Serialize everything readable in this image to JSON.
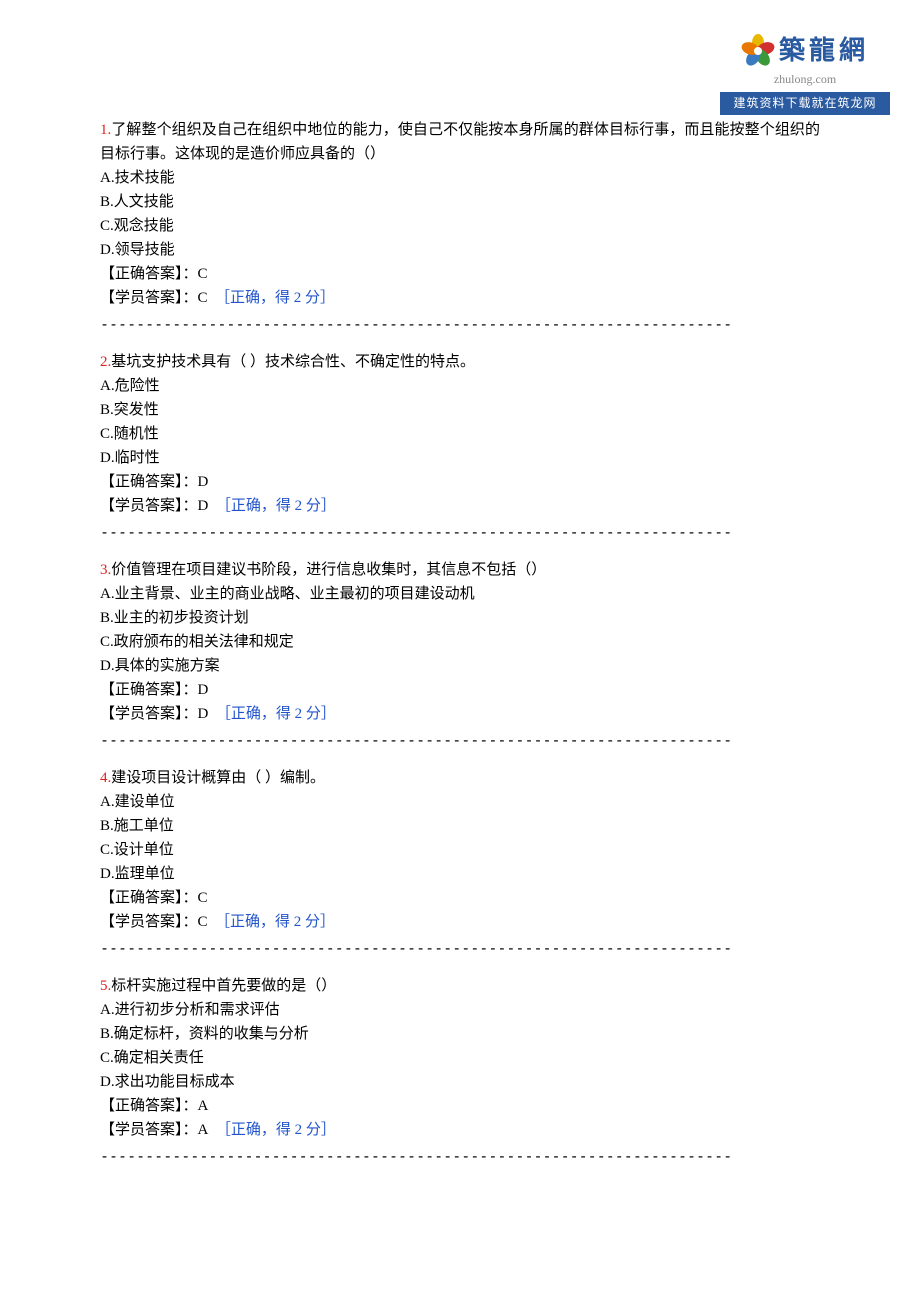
{
  "logo": {
    "cn": "築龍網",
    "en": "zhulong.com",
    "banner": "建筑资料下载就在筑龙网"
  },
  "divider": "----------------------------------------------------------------------",
  "labels": {
    "correct_prefix": "【正确答案】：",
    "student_prefix": "【学员答案】：",
    "result": "［正确，得 2 分］"
  },
  "questions": [
    {
      "num": "1.",
      "text": "了解整个组织及自己在组织中地位的能力，使自己不仅能按本身所属的群体目标行事，而且能按整个组织的目标行事。这体现的是造价师应具备的（）",
      "options": [
        "A.技术技能",
        "B.人文技能",
        "C.观念技能",
        "D.领导技能"
      ],
      "correct": "C",
      "student": "C"
    },
    {
      "num": "2.",
      "text": "基坑支护技术具有（ ）技术综合性、不确定性的特点。",
      "options": [
        "A.危险性",
        "B.突发性",
        "C.随机性",
        "D.临时性"
      ],
      "correct": "D",
      "student": "D"
    },
    {
      "num": "3.",
      "text": "价值管理在项目建议书阶段，进行信息收集时，其信息不包括（）",
      "options": [
        "A.业主背景、业主的商业战略、业主最初的项目建设动机",
        "B.业主的初步投资计划",
        "C.政府颁布的相关法律和规定",
        "D.具体的实施方案"
      ],
      "correct": "D",
      "student": "D"
    },
    {
      "num": "4.",
      "text": "建设项目设计概算由（ ）编制。",
      "options": [
        "A.建设单位",
        "B.施工单位",
        "C.设计单位",
        "D.监理单位"
      ],
      "correct": "C",
      "student": "C"
    },
    {
      "num": "5.",
      "text": "标杆实施过程中首先要做的是（）",
      "options": [
        "A.进行初步分析和需求评估",
        "B.确定标杆，资料的收集与分析",
        "C.确定相关责任",
        "D.求出功能目标成本"
      ],
      "correct": "A",
      "student": "A"
    }
  ]
}
